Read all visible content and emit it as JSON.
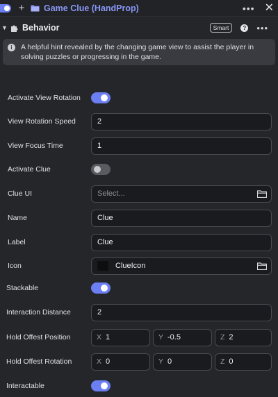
{
  "header": {
    "title": "Game Clue (HandProp)"
  },
  "section": {
    "title": "Behavior",
    "badge": "Smart"
  },
  "hint": {
    "text": "A helpful hint revealed by the changing game view to assist the player in solving puzzles or progressing in the game."
  },
  "properties": {
    "activate_view_rotation": {
      "label": "Activate View Rotation",
      "on": true
    },
    "view_rotation_speed": {
      "label": "View Rotation Speed",
      "value": "2"
    },
    "view_focus_time": {
      "label": "View Focus Time",
      "value": "1"
    },
    "activate_clue": {
      "label": "Activate Clue",
      "on": false
    },
    "clue_ui": {
      "label": "Clue UI",
      "placeholder": "Select..."
    },
    "name": {
      "label": "Name",
      "value": "Clue"
    },
    "label": {
      "label": "Label",
      "value": "Clue"
    },
    "icon": {
      "label": "Icon",
      "value": "ClueIcon"
    },
    "stackable": {
      "label": "Stackable",
      "on": true
    },
    "interaction_distance": {
      "label": "Interaction Distance",
      "value": "2"
    },
    "hold_offset_position": {
      "label": "Hold Offest Position",
      "x_label": "X",
      "x": "1",
      "y_label": "Y",
      "y": "-0.5",
      "z_label": "Z",
      "z": "2"
    },
    "hold_offset_rotation": {
      "label": "Hold Offest Rotation",
      "x_label": "X",
      "x": "0",
      "y_label": "Y",
      "y": "0",
      "z_label": "Z",
      "z": "0"
    },
    "interactable": {
      "label": "Interactable",
      "on": true
    }
  },
  "colors": {
    "accent": "#6b7ff3",
    "title": "#8897f5",
    "background": "#25262a",
    "field": "#1a1b1e"
  }
}
